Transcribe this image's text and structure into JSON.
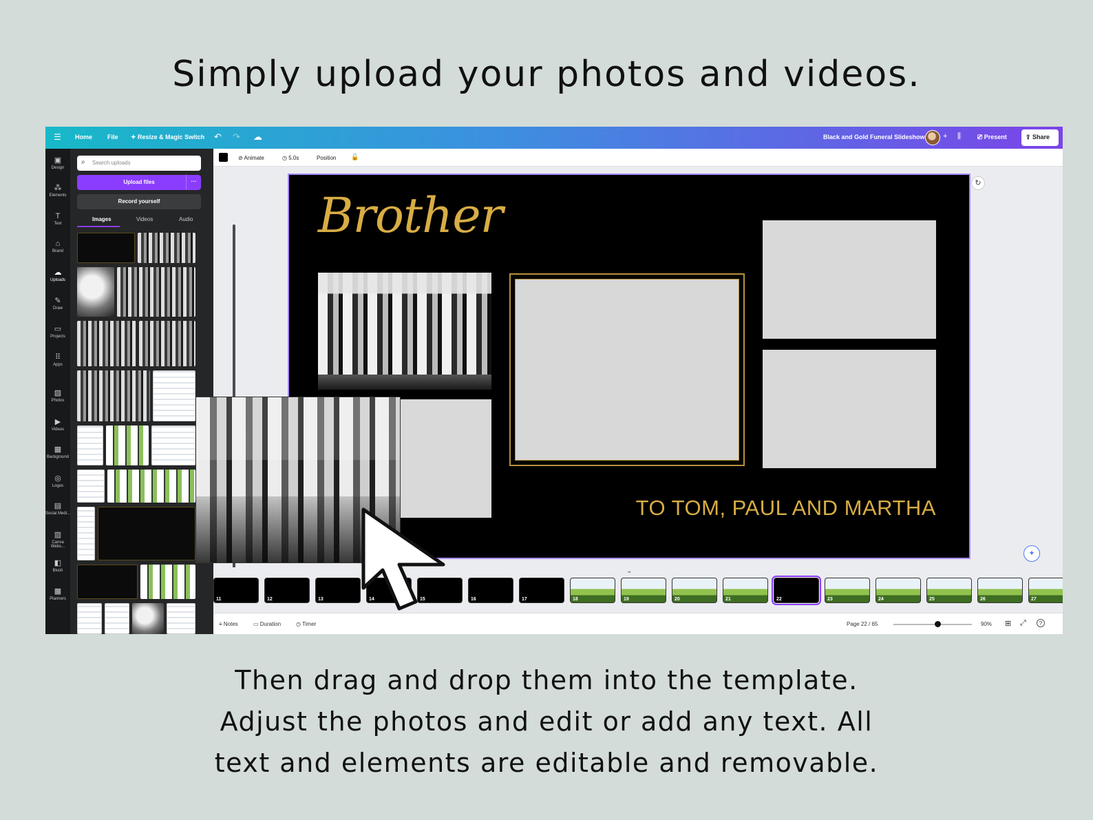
{
  "heading": "Simply upload your photos and videos.",
  "bottom_text": {
    "line1": "Then drag and drop them into the template.",
    "line2": "Adjust the photos and edit or add any text. All",
    "line3": "text and elements are editable and removable."
  },
  "topbar": {
    "menu_icon": "☰",
    "home": "Home",
    "file": "File",
    "resize": "✦ Resize & Magic Switch",
    "undo": "↶",
    "redo": "↷",
    "cloud": "☁",
    "doc_title": "Black and Gold Funeral Slideshow",
    "add": "+",
    "stats": "⫼",
    "present": "⎚ Present",
    "share": "⇪ Share",
    "gradient_start": "#17b9c8",
    "gradient_end": "#7b44e8"
  },
  "rail": [
    {
      "icon": "▣",
      "label": "Design"
    },
    {
      "icon": "⁂",
      "label": "Elements"
    },
    {
      "icon": "T",
      "label": "Text"
    },
    {
      "icon": "⌂",
      "label": "Brand"
    },
    {
      "icon": "☁",
      "label": "Uploads"
    },
    {
      "icon": "✎",
      "label": "Draw"
    },
    {
      "icon": "▭",
      "label": "Projects"
    },
    {
      "icon": "⠿",
      "label": "Apps"
    },
    {
      "icon": "▨",
      "label": "Photos"
    },
    {
      "icon": "▶",
      "label": "Videos"
    },
    {
      "icon": "▦",
      "label": "Background"
    },
    {
      "icon": "◎",
      "label": "Logos"
    },
    {
      "icon": "▤",
      "label": "Social Medi..."
    },
    {
      "icon": "▥",
      "label": "Canva Webs..."
    },
    {
      "icon": "◧",
      "label": "Blush"
    },
    {
      "icon": "▩",
      "label": "Planners"
    }
  ],
  "panel": {
    "search_icon": "⌕",
    "search_placeholder": "Search uploads",
    "upload_label": "Upload files",
    "more": "···",
    "record_label": "Record yourself",
    "tabs": [
      "Images",
      "Videos",
      "Audio"
    ]
  },
  "context_bar": {
    "animate": "⊘ Animate",
    "duration": "◷ 5.0s",
    "position": "Position",
    "lock": "🔓"
  },
  "slide": {
    "script_title": "Brother",
    "tribute": "TO TOM, PAUL AND MARTHA",
    "gold": "#d8ad45"
  },
  "canvas_icons": {
    "refresh": "↻",
    "magic": "✦"
  },
  "filmstrip": {
    "collapse": "⌄",
    "pages": [
      {
        "n": "11",
        "kind": "dark"
      },
      {
        "n": "12",
        "kind": "dark"
      },
      {
        "n": "13",
        "kind": "dark"
      },
      {
        "n": "14",
        "kind": "dark"
      },
      {
        "n": "15",
        "kind": "dark"
      },
      {
        "n": "16",
        "kind": "dark"
      },
      {
        "n": "17",
        "kind": "dark"
      },
      {
        "n": "18",
        "kind": "land"
      },
      {
        "n": "19",
        "kind": "land"
      },
      {
        "n": "20",
        "kind": "land"
      },
      {
        "n": "21",
        "kind": "land"
      },
      {
        "n": "22",
        "kind": "active"
      },
      {
        "n": "23",
        "kind": "land"
      },
      {
        "n": "24",
        "kind": "land"
      },
      {
        "n": "25",
        "kind": "land"
      },
      {
        "n": "26",
        "kind": "land"
      },
      {
        "n": "27",
        "kind": "land"
      }
    ]
  },
  "footer": {
    "notes": "≡ Notes",
    "duration": "▭ Duration",
    "timer": "◷ Timer",
    "page": "Page 22 / 65",
    "zoom": "90%",
    "grid": "⊞",
    "expand": "⤢",
    "help": "?"
  }
}
